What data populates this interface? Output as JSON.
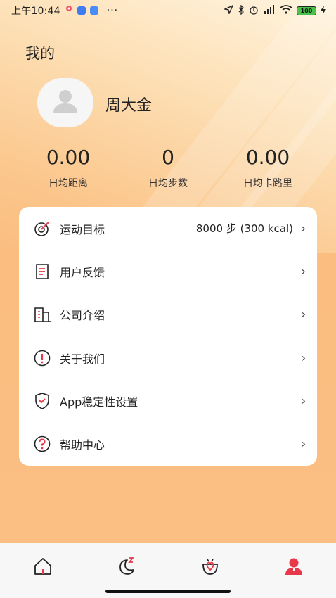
{
  "status_bar": {
    "time": "上午10:44",
    "more": "···",
    "battery": "100"
  },
  "colors": {
    "accent": "#e8394a",
    "background_top": "#fde1b8",
    "background_bottom": "#fbbd80",
    "card": "#ffffff"
  },
  "header": {
    "title": "我的"
  },
  "profile": {
    "name": "周大金",
    "avatar_icon": "user-avatar-icon"
  },
  "stats": [
    {
      "value": "0.00",
      "label": "日均距离"
    },
    {
      "value": "0",
      "label": "日均步数"
    },
    {
      "value": "0.00",
      "label": "日均卡路里"
    }
  ],
  "menu": [
    {
      "icon": "target-icon",
      "label": "运动目标",
      "value": "8000 步 (300 kcal)"
    },
    {
      "icon": "feedback-document-icon",
      "label": "用户反馈",
      "value": ""
    },
    {
      "icon": "building-icon",
      "label": "公司介绍",
      "value": ""
    },
    {
      "icon": "exclamation-circle-icon",
      "label": "关于我们",
      "value": ""
    },
    {
      "icon": "shield-check-icon",
      "label": "App稳定性设置",
      "value": ""
    },
    {
      "icon": "question-circle-icon",
      "label": "帮助中心",
      "value": ""
    }
  ],
  "chevron": "›",
  "bottom_nav": [
    {
      "icon": "home-icon",
      "active": false
    },
    {
      "icon": "sleep-moon-icon",
      "active": false
    },
    {
      "icon": "heart-basket-icon",
      "active": false
    },
    {
      "icon": "profile-icon",
      "active": true
    }
  ]
}
